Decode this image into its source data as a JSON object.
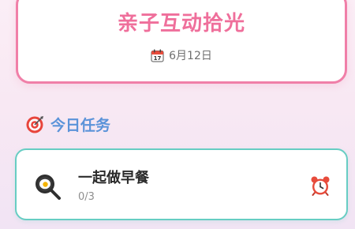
{
  "header": {
    "title": "亲子互动拾光",
    "date": "6月12日",
    "date_icon": "calendar-icon"
  },
  "section": {
    "title": "今日任务",
    "icon": "target-icon"
  },
  "tasks": [
    {
      "title": "一起做早餐",
      "progress": "0/3",
      "icon": "frying-pan-icon",
      "action_icon": "alarm-clock-icon"
    }
  ],
  "colors": {
    "title_pink": "#ef6f9b",
    "header_border": "#f07fa8",
    "section_blue": "#5b93d9",
    "task_border": "#67cdc3"
  }
}
